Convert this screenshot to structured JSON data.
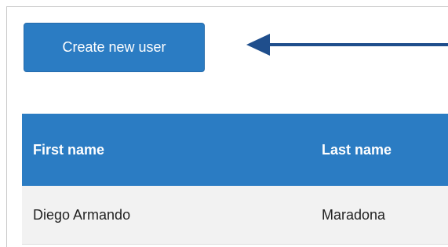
{
  "toolbar": {
    "create_button_label": "Create new user"
  },
  "table": {
    "columns": [
      "First name",
      "Last name"
    ],
    "rows": [
      [
        "Diego Armando",
        "Maradona"
      ]
    ]
  },
  "colors": {
    "accent": "#2b7cc3",
    "arrow": "#1f4e8c"
  }
}
